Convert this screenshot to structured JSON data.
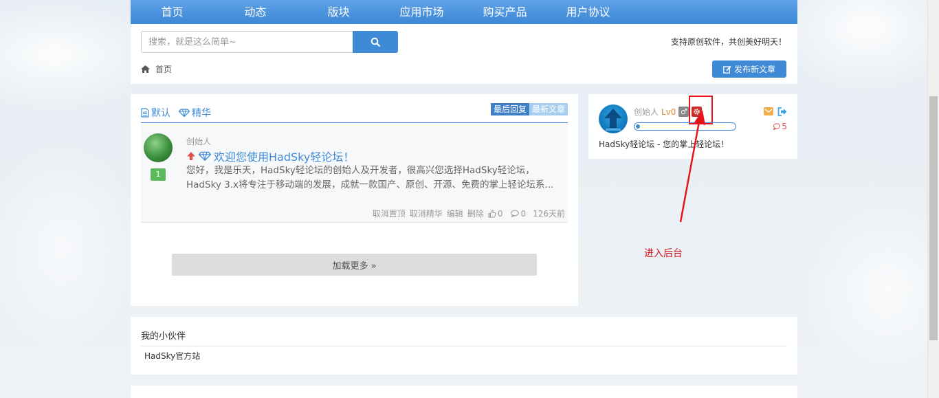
{
  "nav": {
    "items": [
      {
        "label": "首页"
      },
      {
        "label": "动态"
      },
      {
        "label": "版块"
      },
      {
        "label": "应用市场"
      },
      {
        "label": "购买产品"
      },
      {
        "label": "用户协议"
      }
    ]
  },
  "header": {
    "search_placeholder": "搜索，就是这么简单~",
    "search_icon": "search-icon",
    "slogan": "支持原创软件，共创美好明天！",
    "breadcrumb_home": "首页",
    "publish_label": "发布新文章"
  },
  "main": {
    "tabs": [
      {
        "label": "默认",
        "icon": "document-icon"
      },
      {
        "label": "精华",
        "icon": "diamond-icon"
      }
    ],
    "sort": {
      "last_reply": "最后回复",
      "newest": "最新文章"
    },
    "posts": [
      {
        "author": "创始人",
        "count": "1",
        "title": "欢迎您使用HadSky轻论坛！",
        "excerpt_line1": "您好，我是乐天，HadSky轻论坛的创始人及开发者，很高兴您选择HadSky轻论坛，",
        "excerpt_line2": "HadSky 3.x将专注于移动端的发展，成就一款国产、原创、开源、免费的掌上轻论坛系...",
        "actions": {
          "unpin": "取消置顶",
          "unfeature": "取消精华",
          "edit": "编辑",
          "delete": "删除",
          "likes": "0",
          "comments": "0",
          "time": "126天前"
        }
      }
    ],
    "load_more": "加载更多 »"
  },
  "user": {
    "name": "创始人",
    "level": "Lv0",
    "gender_symbol": "♂",
    "exp_progress": 0.03,
    "messages": "5",
    "bio": "HadSky轻论坛 - 您的掌上轻论坛！",
    "colors": {
      "admin_badge": "#c9302c",
      "highlight": "#e8141c"
    }
  },
  "annotation": {
    "text": "进入后台",
    "color": "#d9141b"
  },
  "partners": {
    "title": "我的小伙伴",
    "links": [
      {
        "label": "HadSky官方站"
      }
    ]
  },
  "colors": {
    "accent": "#3e8ad6",
    "nav": "#4a94de"
  }
}
